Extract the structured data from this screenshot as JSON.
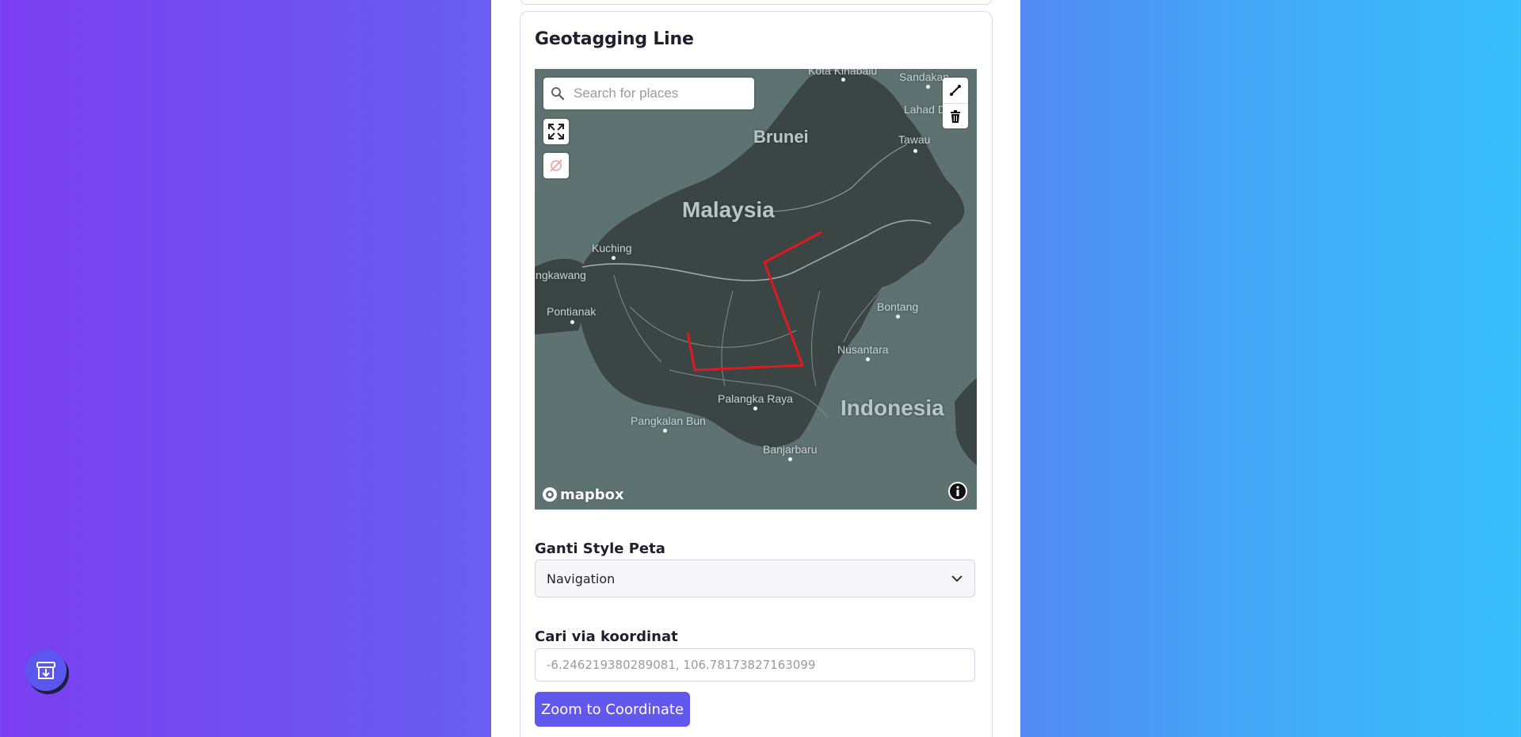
{
  "card": {
    "title": "Geotagging Line"
  },
  "map": {
    "search_placeholder": "Search for places",
    "attribution_logo": "mapbox",
    "labels": {
      "country_malaysia": "Malaysia",
      "country_brunei": "Brunei",
      "country_indonesia": "Indonesia",
      "kota_kinabalu": "Kota Kinabalu",
      "sandakan": "Sandakan",
      "lahad_datu": "Lahad Datu",
      "tawau": "Tawau",
      "kuching": "Kuching",
      "singkawang": "ingkawang",
      "pontianak": "Pontianak",
      "bontang": "Bontang",
      "nusantara": "Nusantara",
      "palangka_raya": "Palangka Raya",
      "pangkalan_bun": "Pangkalan Bun",
      "banjarbaru": "Banjarbaru"
    },
    "line_color": "#e0191f"
  },
  "style_section": {
    "label": "Ganti Style Peta",
    "selected": "Navigation"
  },
  "coord_section": {
    "label": "Cari via koordinat",
    "placeholder": "-6.246219380289081, 106.78173827163099",
    "button_label": "Zoom to Coordinate"
  },
  "colors": {
    "accent": "#6158ee"
  }
}
